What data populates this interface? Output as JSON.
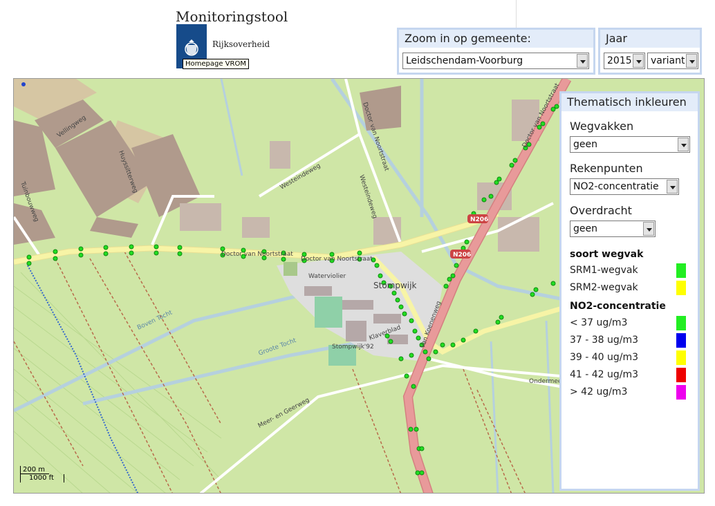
{
  "header": {
    "title": "Monitoringstool",
    "logo_text": "Rijksoverheid",
    "logo_tooltip": "Homepage VROM"
  },
  "zoom": {
    "title": "Zoom in op gemeente:",
    "selected": "Leidschendam-Voorburg"
  },
  "jaar": {
    "title": "Jaar",
    "year": "2015",
    "variant": "variant"
  },
  "map": {
    "labels": {
      "vellingweg": "Vellingweg",
      "huyssitterweg": "Huyssitterweg",
      "tuinbouwweg": "Tuinbouwweg",
      "westeindeweg_1": "Westeindeweg",
      "westeindeweg_2": "Westeindeweg",
      "doctor_1": "Doctor van Noortstraat",
      "doctor_2": "Doctor van Noortstraat",
      "doctor_3": "Doctor van Noortstraat",
      "doctor_4": "Doctor van Noortstraat",
      "waterviolier": "Waterviolier",
      "stompwijk": "Stompwijk",
      "stompwijk92": "Stompwijk'92",
      "klaverblad": "Klaverblad",
      "n206_1": "N206",
      "n206_2": "N206",
      "van_koenenweg": "Van Koenenweg",
      "meer_en_geerweg": "Meer- en Geerweg",
      "ondermeer": "Ondermeer",
      "groote_tocht": "Groote Tocht",
      "bovent_tocht": "Boven Tocht"
    },
    "scale": {
      "metric": "200 m",
      "imperial": "1000 ft"
    }
  },
  "theme": {
    "title": "Thematisch inkleuren",
    "wegvakken_label": "Wegvakken",
    "wegvakken_value": "geen",
    "rekenpunten_label": "Rekenpunten",
    "rekenpunten_value": "NO2-concentratie",
    "overdracht_label": "Overdracht",
    "overdracht_value": "geen",
    "soort_title": "soort wegvak",
    "soort_items": [
      {
        "label": "SRM1-wegvak",
        "color": "#22ee22"
      },
      {
        "label": "SRM2-wegvak",
        "color": "#ffff00"
      }
    ],
    "no2_title": "NO2-concentratie",
    "no2_items": [
      {
        "label": "< 37 ug/m3",
        "color": "#22ee22"
      },
      {
        "label": "37 - 38 ug/m3",
        "color": "#0000ee"
      },
      {
        "label": "39 - 40 ug/m3",
        "color": "#ffff00"
      },
      {
        "label": "41 - 42 ug/m3",
        "color": "#ee0000"
      },
      {
        "label": "> 42 ug/m3",
        "color": "#ee00ee"
      }
    ]
  },
  "colors": {
    "panel_border": "#c5d6ef",
    "panel_head": "#e3ecf9",
    "map_grass": "#cfe6a6",
    "road_yellow": "#f7f4a6",
    "road_main": "#e89a9a",
    "point": "#22dd22"
  }
}
